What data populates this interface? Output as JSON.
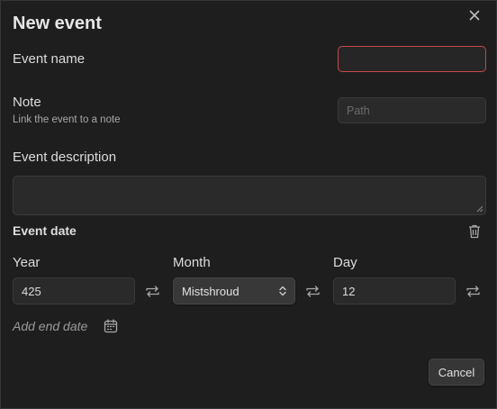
{
  "modal": {
    "title": "New event",
    "close_icon": "close-icon"
  },
  "event_name": {
    "label": "Event name",
    "value": "",
    "state": "invalid"
  },
  "note": {
    "label": "Note",
    "sublabel": "Link the event to a note",
    "placeholder": "Path",
    "value": ""
  },
  "description": {
    "label": "Event description",
    "value": ""
  },
  "event_date": {
    "title": "Event date",
    "delete_icon": "trash-icon",
    "year": {
      "label": "Year",
      "value": "425",
      "toggle_icon": "swap-icon"
    },
    "month": {
      "label": "Month",
      "value": "Mistshroud",
      "toggle_icon": "swap-icon"
    },
    "day": {
      "label": "Day",
      "value": "12",
      "toggle_icon": "swap-icon"
    }
  },
  "end_date": {
    "label": "Add end date",
    "icon": "calendar-icon"
  },
  "actions": {
    "cancel_label": "Cancel"
  },
  "colors": {
    "background": "#1e1e1e",
    "input_bg": "#2a2a2a",
    "error_border": "#c9484b",
    "select_bg": "#383838"
  }
}
